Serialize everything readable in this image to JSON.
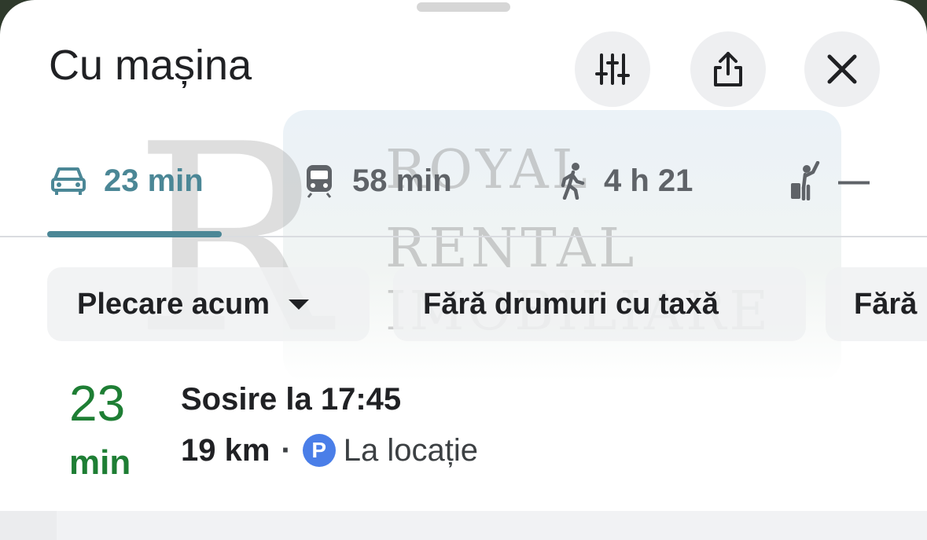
{
  "header": {
    "title": "Cu mașina",
    "actions": [
      {
        "name": "filter-options-button",
        "icon": "sliders-icon"
      },
      {
        "name": "share-button",
        "icon": "share-icon"
      },
      {
        "name": "close-button",
        "icon": "close-icon"
      }
    ]
  },
  "modes": [
    {
      "icon": "car-icon",
      "label": "23 min",
      "selected": true
    },
    {
      "icon": "train-icon",
      "label": "58 min",
      "selected": false
    },
    {
      "icon": "walk-icon",
      "label": "4 h 21",
      "selected": false
    },
    {
      "icon": "ride-hail-icon",
      "label": "—",
      "selected": false
    }
  ],
  "chips": [
    {
      "label": "Plecare acum",
      "has_dropdown": true
    },
    {
      "label": "Fără drumuri cu taxă"
    },
    {
      "label": "Fără"
    }
  ],
  "watermark": {
    "letters": "R",
    "line1": "ROYAL",
    "line2": "RENTAL",
    "line3": "IMOBILIARE"
  },
  "route": {
    "duration_value": "23",
    "duration_unit": "min",
    "arrival": "Sosire la 17:45",
    "distance": "19 km",
    "separator": "·",
    "parking_badge": "P",
    "parking_text": "La locație"
  },
  "colors": {
    "selected_mode": "#4b8796",
    "unselected_mode": "#5f6368",
    "duration_green": "#1e7e34",
    "parking_blue": "#4a7ee8"
  }
}
